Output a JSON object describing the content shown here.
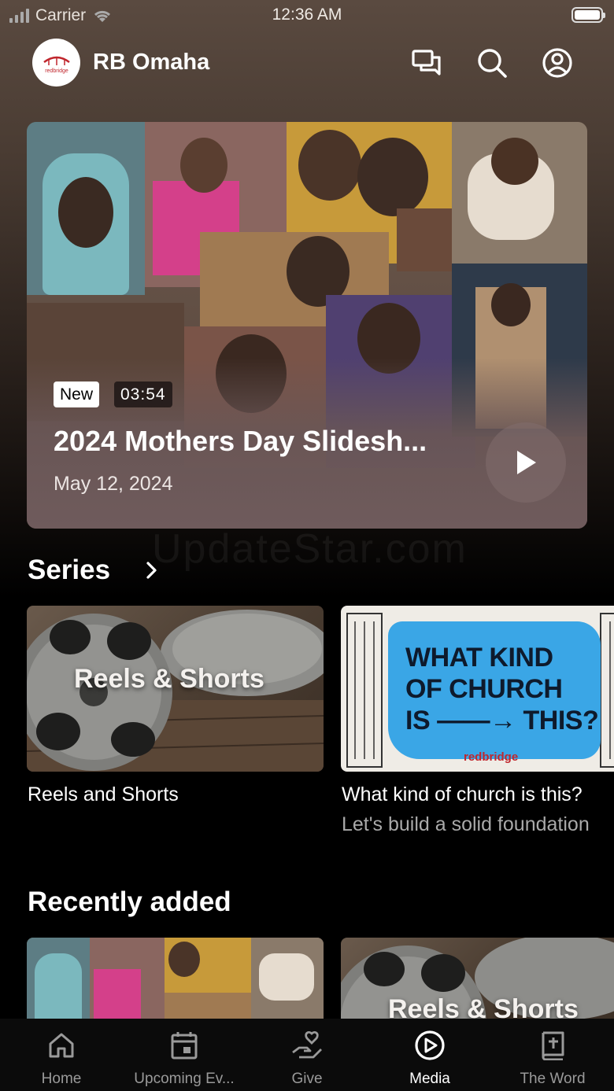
{
  "status_bar": {
    "carrier": "Carrier",
    "time": "12:36 AM"
  },
  "header": {
    "logo_text": "redbridge",
    "title": "RB Omaha",
    "icons": [
      "chat-icon",
      "search-icon",
      "account-icon"
    ]
  },
  "featured": {
    "badge": "New",
    "duration": "03:54",
    "title": "2024 Mothers Day Slidesh...",
    "date": "May 12, 2024"
  },
  "watermark": "UpdateStar.com",
  "series": {
    "title": "Series",
    "items": [
      {
        "thumb_text": "Reels & Shorts",
        "title": "Reels and Shorts",
        "subtitle": ""
      },
      {
        "thumb_lines": [
          "WHAT  KIND",
          "OF CHURCH",
          "IS ——→ THIS?"
        ],
        "thumb_brand": "redbridge",
        "title": "What kind of church is this?",
        "subtitle": "Let's build a solid foundation"
      }
    ]
  },
  "recently_added": {
    "title": "Recently added",
    "items": [
      {
        "thumb": "collage"
      },
      {
        "thumb_text": "Reels & Shorts"
      }
    ]
  },
  "tabs": [
    {
      "label": "Home",
      "icon": "home-icon",
      "active": false
    },
    {
      "label": "Upcoming Ev...",
      "icon": "calendar-icon",
      "active": false
    },
    {
      "label": "Give",
      "icon": "give-icon",
      "active": false
    },
    {
      "label": "Media",
      "icon": "media-play-icon",
      "active": true
    },
    {
      "label": "The Word",
      "icon": "bible-icon",
      "active": false
    }
  ],
  "colors": {
    "accent": "#ffffff",
    "inactive": "#9a9a9a",
    "brand_red": "#c0262d",
    "church_blue": "#3aa6e6"
  }
}
